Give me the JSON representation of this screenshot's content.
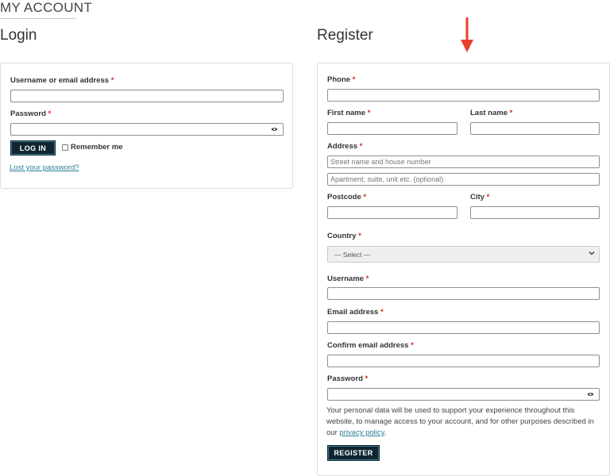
{
  "header": {
    "title": "MY ACCOUNT"
  },
  "login": {
    "title": "Login",
    "username_label": "Username or email address",
    "password_label": "Password",
    "submit_label": "LOG IN",
    "remember_label": "Remember me",
    "lost_password_link": "Lost your password?"
  },
  "register": {
    "title": "Register",
    "phone_label": "Phone",
    "first_name_label": "First name",
    "last_name_label": "Last name",
    "address_label": "Address",
    "address1_placeholder": "Street name and house number",
    "address2_placeholder": "Apartment, suite, unit etc. (optional)",
    "postcode_label": "Postcode",
    "city_label": "City",
    "country_label": "Country",
    "country_selected": "— Select —",
    "username_label": "Username",
    "email_label": "Email address",
    "confirm_email_label": "Confirm email address",
    "password_label": "Password",
    "privacy_text": "Your personal data will be used to support your experience throughout this website, to manage access to your account, and for other purposes described in our",
    "privacy_link": "privacy policy",
    "privacy_end": ".",
    "submit_label": "REGISTER"
  },
  "required_marker": "*",
  "colors": {
    "accent": "#0f2632",
    "required": "#d62b1e",
    "link": "#2a8096",
    "arrow": "#e8402b"
  }
}
